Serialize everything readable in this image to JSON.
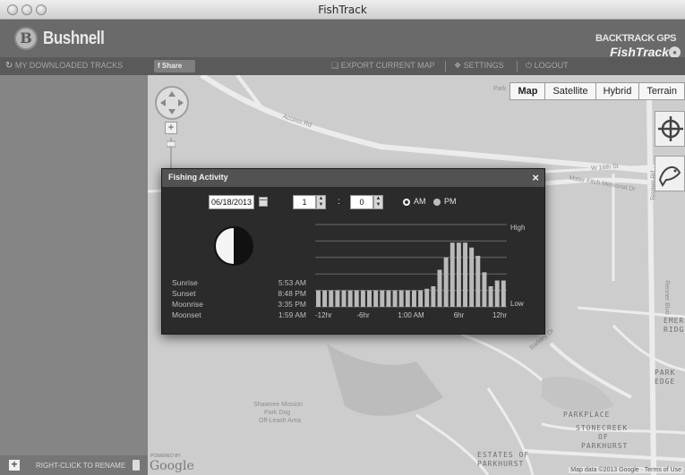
{
  "window": {
    "title": "FishTrack"
  },
  "header": {
    "brand": "Bushnell",
    "product_line1": "BACKTRACK GPS",
    "product_line2": "FishTrack"
  },
  "toolbar": {
    "downloaded_tracks": "MY DOWNLOADED TRACKS",
    "share": "Share",
    "export": "EXPORT CURRENT MAP",
    "settings": "SETTINGS",
    "logout": "LOGOUT"
  },
  "sidebar": {
    "footer_label": "RIGHT-CLICK TO RENAME"
  },
  "map": {
    "types": [
      "Map",
      "Satellite",
      "Hybrid",
      "Terrain"
    ],
    "active_type": "Map",
    "labels": {
      "access_rd": "Access Rd",
      "w_16th": "W 16th St",
      "mater_fitch": "Mater Fitch Memorial Dr",
      "tesmer": "Tesmer Rd",
      "park": "Park",
      "shawnee": "Shawnee Mission",
      "dog_park": "Park Dog",
      "off_leash": "Off-Leash Area",
      "parkplace": "PARKPLACE",
      "stonecreek": "STONECREEK",
      "of": "OF",
      "parkhurst": "PARKHURST",
      "estates_of": "ESTATES OF",
      "parkhurst2": "PARKHURST",
      "park_edge_1": "PARK",
      "park_edge_2": "EDGE",
      "eme_1": "EMER",
      "eme_2": "RIDGE",
      "barkley": "Barkley Dr",
      "pflumm": "Pflumm Rd",
      "renner": "Renner Blvd"
    },
    "powered_by": "POWERED BY",
    "google": "Google",
    "credits": "Map data ©2013 Google · Terms of Use"
  },
  "dialog": {
    "title": "Fishing Activity",
    "close": "×",
    "date": "06/18/2013",
    "hour": "1",
    "minute": "0",
    "colon": ":",
    "am_label": "AM",
    "pm_label": "PM",
    "selected_period": "AM",
    "sun_moon": [
      {
        "label": "Sunrise",
        "value": "5:53 AM"
      },
      {
        "label": "Sunset",
        "value": "8:48 PM"
      },
      {
        "label": "Moonrise",
        "value": "3:35 PM"
      },
      {
        "label": "Moonset",
        "value": "1:59 AM"
      }
    ]
  },
  "chart_data": {
    "type": "bar",
    "title": "",
    "ylabel_high": "High",
    "ylabel_low": "Low",
    "x_tick_labels": [
      "-12hr",
      "-6hr",
      "1:00 AM",
      "6hr",
      "12hr"
    ],
    "values": [
      0.2,
      0.2,
      0.2,
      0.2,
      0.2,
      0.2,
      0.2,
      0.2,
      0.2,
      0.2,
      0.2,
      0.2,
      0.2,
      0.2,
      0.2,
      0.2,
      0.2,
      0.22,
      0.25,
      0.45,
      0.6,
      0.78,
      0.78,
      0.78,
      0.72,
      0.62,
      0.42,
      0.25,
      0.32,
      0.32
    ],
    "ylim": [
      0,
      1
    ],
    "grid": true,
    "colors": {
      "bar": "#b9b9b9",
      "grid": "#6a6a6a",
      "text": "#c8c8c8"
    }
  }
}
